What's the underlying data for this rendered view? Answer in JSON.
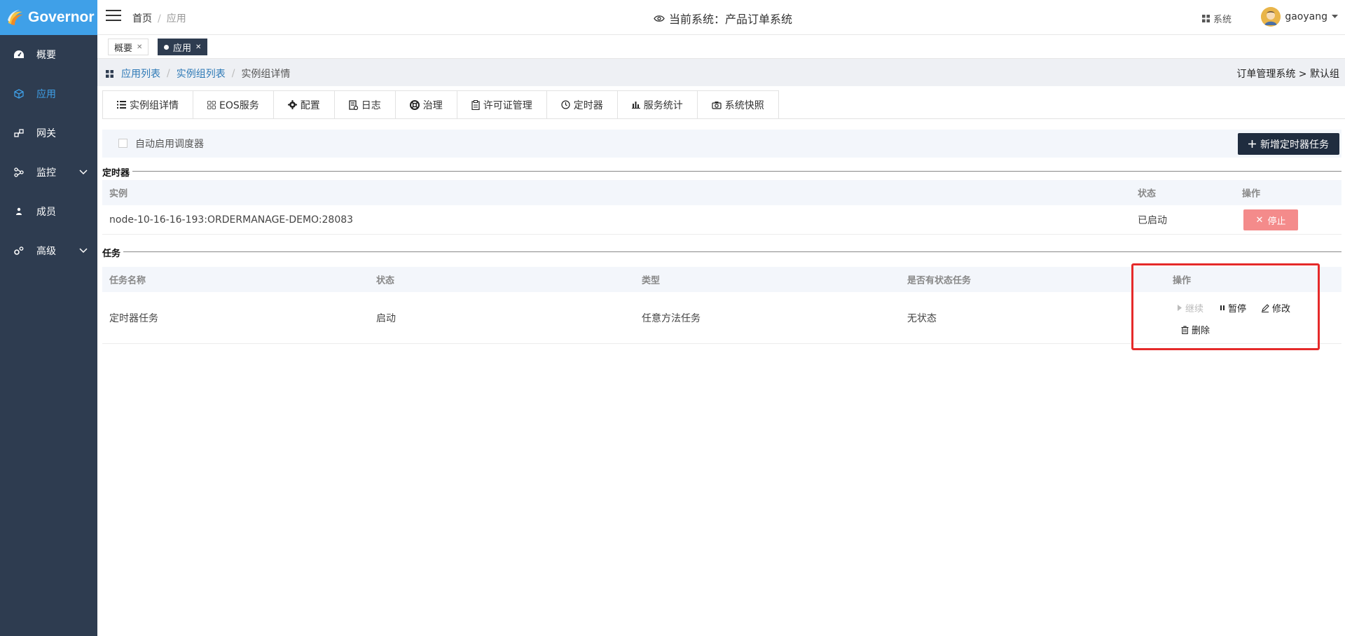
{
  "app": {
    "name": "Governor"
  },
  "sidebar": {
    "items": [
      {
        "label": "概要",
        "icon": "dashboard-icon"
      },
      {
        "label": "应用",
        "icon": "cube-icon",
        "active": true
      },
      {
        "label": "网关",
        "icon": "gateway-icon"
      },
      {
        "label": "监控",
        "icon": "monitor-icon",
        "expandable": true
      },
      {
        "label": "成员",
        "icon": "user-icon"
      },
      {
        "label": "高级",
        "icon": "gears-icon",
        "expandable": true
      }
    ]
  },
  "topbar": {
    "breadcrumb": [
      "首页",
      "应用"
    ],
    "current_system": "当前系统：产品订单系统",
    "system_link": "系统",
    "username": "gaoyang"
  },
  "tags": [
    {
      "label": "概要",
      "active": false
    },
    {
      "label": "应用",
      "active": true
    }
  ],
  "breadcrumb": {
    "items": [
      "应用列表",
      "实例组列表",
      "实例组详情"
    ],
    "right": "订单管理系统 > 默认组"
  },
  "module_tabs": [
    {
      "label": "实例组详情",
      "icon": "list-icon"
    },
    {
      "label": "EOS服务",
      "icon": "grid-icon"
    },
    {
      "label": "配置",
      "icon": "gear-icon"
    },
    {
      "label": "日志",
      "icon": "log-icon"
    },
    {
      "label": "治理",
      "icon": "lifebuoy-icon"
    },
    {
      "label": "许可证管理",
      "icon": "clipboard-icon"
    },
    {
      "label": "定时器",
      "icon": "clock-icon",
      "active": true
    },
    {
      "label": "服务统计",
      "icon": "bar-chart-icon"
    },
    {
      "label": "系统快照",
      "icon": "camera-icon"
    }
  ],
  "toolbar": {
    "auto_enable_label": "自动启用调度器",
    "add_button": "新增定时器任务"
  },
  "timer_section": {
    "title": "定时器",
    "headers": {
      "instance": "实例",
      "status": "状态",
      "action": "操作"
    },
    "rows": [
      {
        "instance": "node-10-16-16-193:ORDERMANAGE-DEMO:28083",
        "status": "已启动",
        "action": "停止"
      }
    ]
  },
  "task_section": {
    "title": "任务",
    "headers": {
      "name": "任务名称",
      "status": "状态",
      "type": "类型",
      "stateful": "是否有状态任务",
      "action": "操作"
    },
    "rows": [
      {
        "name": "定时器任务",
        "status": "启动",
        "type": "任意方法任务",
        "stateful": "无状态",
        "actions": {
          "resume": "继续",
          "pause": "暂停",
          "edit": "修改",
          "delete": "删除"
        }
      }
    ]
  },
  "colors": {
    "sidebar": "#2e3c50",
    "logo_bg": "#3fa0e8",
    "link": "#2d79b6",
    "stop_button": "#f48b8b",
    "highlight": "#e52a2a"
  }
}
